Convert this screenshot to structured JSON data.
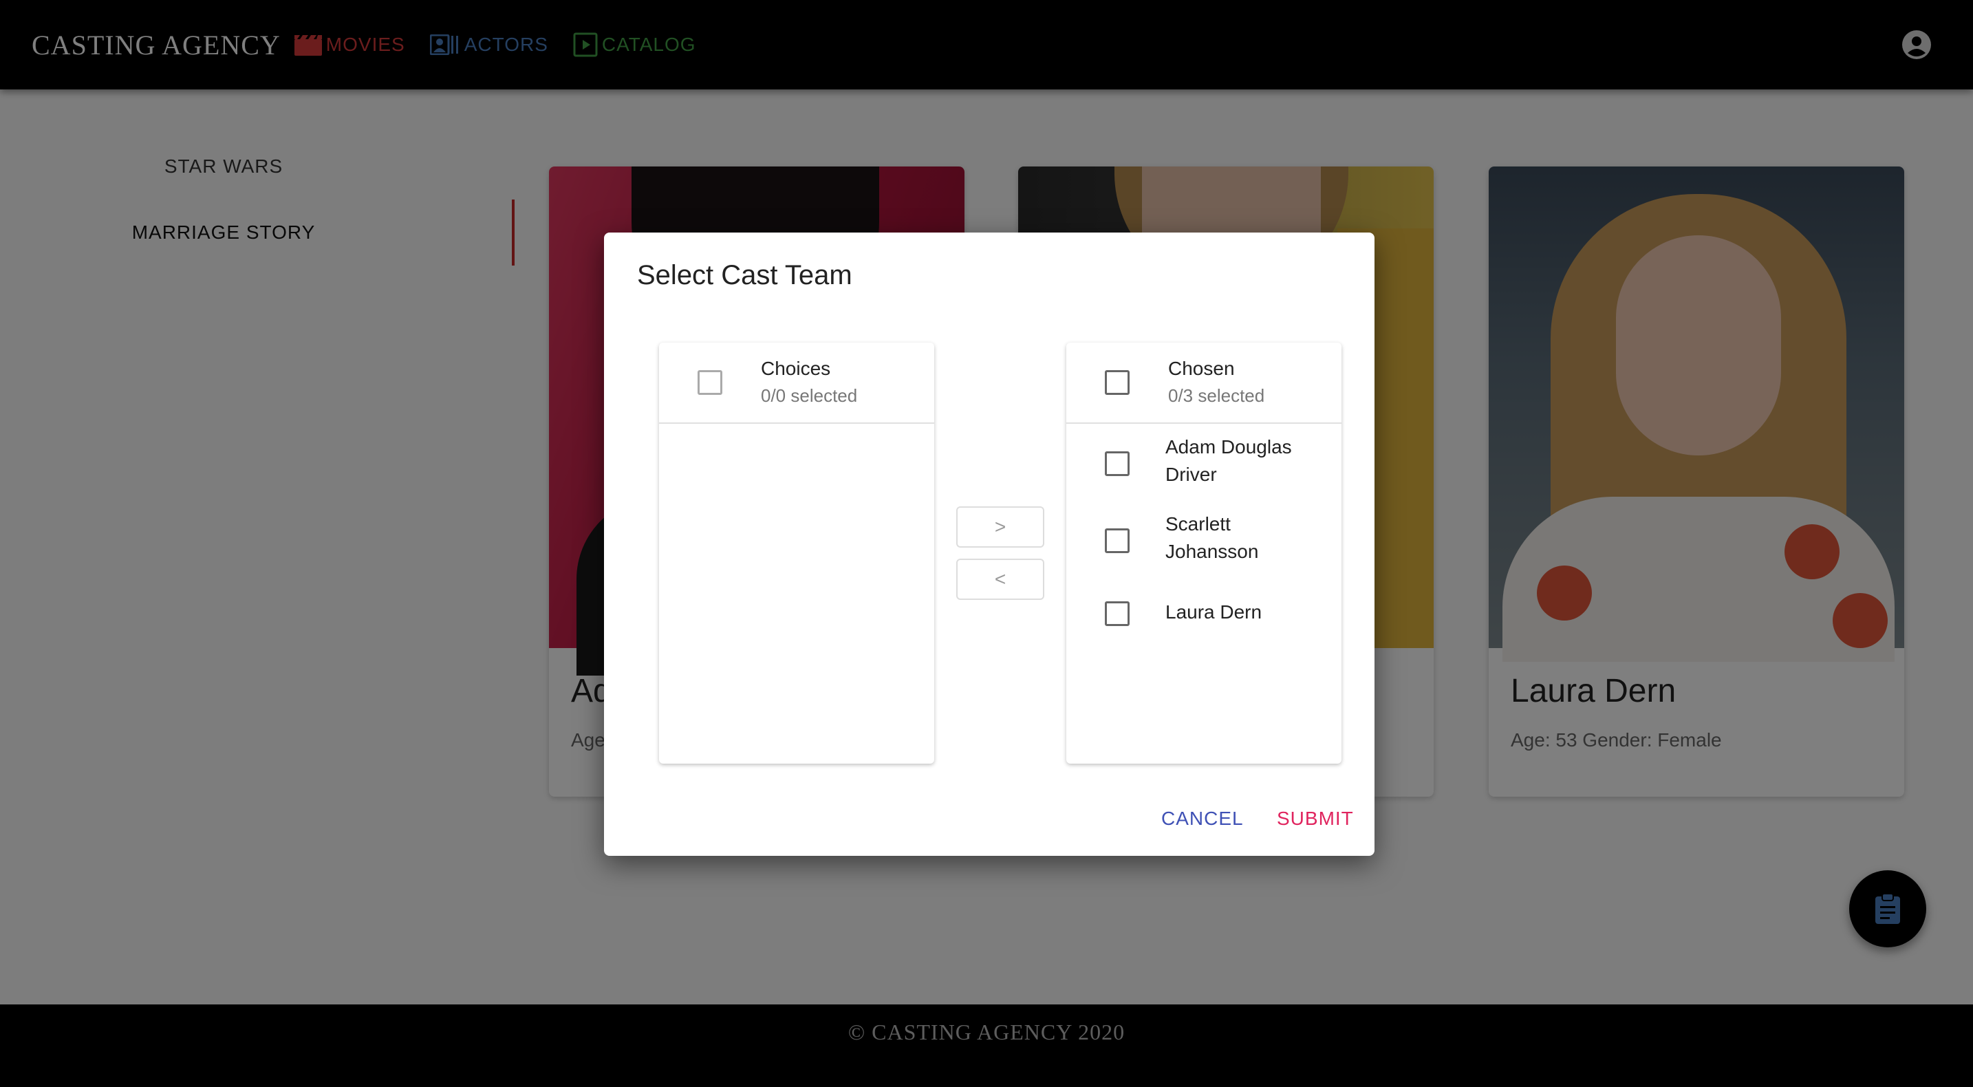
{
  "header": {
    "brand": "CASTING AGENCY",
    "nav": {
      "movies": "MOVIES",
      "actors": "ACTORS",
      "catalog": "CATALOG"
    },
    "colors": {
      "movies": "#d63a3a",
      "actors": "#4a7fc1",
      "catalog": "#43a047"
    },
    "account_icon": "account-circle-icon"
  },
  "sidebar": {
    "items": [
      {
        "label": "STAR WARS"
      },
      {
        "label": "MARRIAGE STORY"
      }
    ],
    "active_index": 1,
    "indicator_color": "#c62828"
  },
  "cards": [
    {
      "name": "Ad",
      "meta": "Age"
    },
    {
      "name": "",
      "meta": ""
    },
    {
      "name": "Laura Dern",
      "meta": "Age: 53 Gender: Female"
    }
  ],
  "dialog": {
    "title": "Select Cast Team",
    "choices": {
      "title": "Choices",
      "subtitle": "0/0 selected",
      "items": []
    },
    "chosen": {
      "title": "Chosen",
      "subtitle": "0/3 selected",
      "items": [
        {
          "line1": "Adam Douglas",
          "line2": "Driver"
        },
        {
          "line1": "Scarlett",
          "line2": "Johansson"
        },
        {
          "line1": "Laura Dern",
          "line2": ""
        }
      ]
    },
    "move_right": ">",
    "move_left": "<",
    "cancel": "CANCEL",
    "submit": "SUBMIT",
    "cancel_color": "#3f51b5",
    "submit_color": "#e0245e"
  },
  "fab": {
    "icon": "clipboard-icon",
    "color": "#4a7fc1"
  },
  "footer": {
    "text": "© CASTING AGENCY 2020"
  }
}
